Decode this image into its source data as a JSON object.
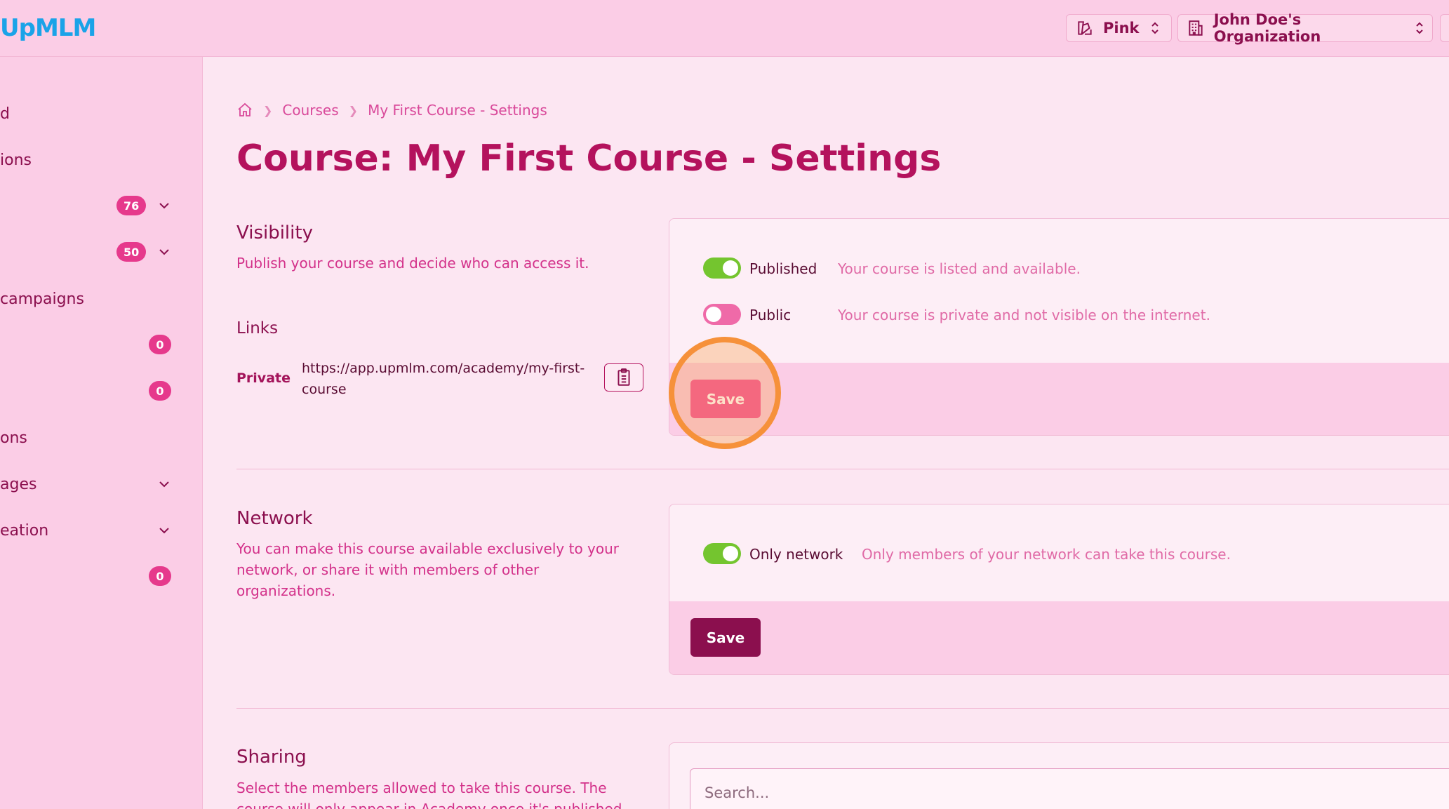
{
  "header": {
    "logo": "UpMLM",
    "theme_selector": {
      "label": "Pink",
      "icon": "palette-icon"
    },
    "org_selector": {
      "label": "John Doe's Organization",
      "icon": "building-icon"
    }
  },
  "sidebar": {
    "items": [
      {
        "label": "d"
      },
      {
        "label": "ions"
      },
      {
        "label": "",
        "badge": "76",
        "chevron": true
      },
      {
        "label": "",
        "badge": "50",
        "chevron": true
      },
      {
        "label": "campaigns"
      },
      {
        "label": "",
        "badge": "0"
      },
      {
        "label": "",
        "badge": "0"
      },
      {
        "label": "ons"
      },
      {
        "label": "ages",
        "chevron": true
      },
      {
        "label": "eation",
        "chevron": true
      },
      {
        "label": "",
        "badge": "0"
      }
    ]
  },
  "breadcrumb": {
    "home_icon": "home-icon",
    "items": [
      "Courses",
      "My First Course - Settings"
    ]
  },
  "page_title": "Course: My First Course - Settings",
  "visibility": {
    "title": "Visibility",
    "description": "Publish your course and decide who can access it.",
    "links_title": "Links",
    "private_label": "Private",
    "private_url": "https://app.upmlm.com/academy/my-first-course",
    "toggles": [
      {
        "label": "Published",
        "state": "on",
        "description": "Your course is listed and available."
      },
      {
        "label": "Public",
        "state": "off",
        "description": "Your course is private and not visible on the internet."
      }
    ],
    "save_label": "Save"
  },
  "network": {
    "title": "Network",
    "description": "You can make this course available exclusively to your network, or share it with members of other organizations.",
    "toggle": {
      "label": "Only network",
      "state": "on",
      "description": "Only members of your network can take this course."
    },
    "save_label": "Save"
  },
  "sharing": {
    "title": "Sharing",
    "description": "Select the members allowed to take this course. The course will only appear in Academy once it's published.",
    "search_placeholder": "Search..."
  },
  "colors": {
    "accent": "#b4125d",
    "toggle_on": "#74c52f",
    "toggle_off": "#ef6aa8",
    "highlight": "#f6913a"
  }
}
